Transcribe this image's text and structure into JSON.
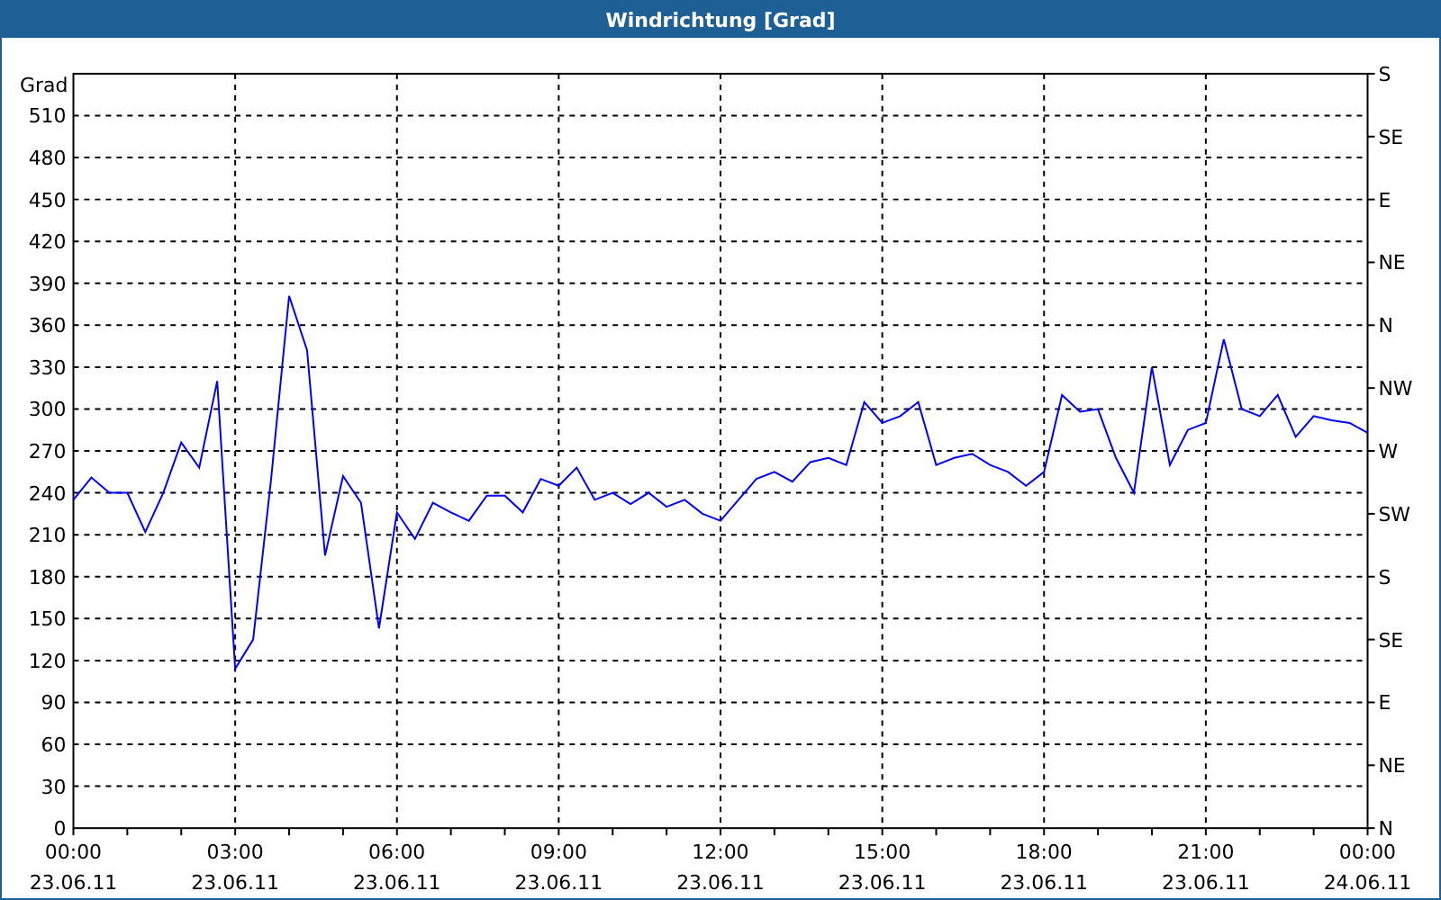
{
  "window": {
    "title": "Windrichtung [Grad]"
  },
  "chart": {
    "compass_labels": [
      "S",
      "SE",
      "E",
      "NE",
      "N",
      "NW",
      "W",
      "SW",
      "S",
      "SE",
      "E",
      "NE",
      "N"
    ],
    "chart_data": {
      "type": "line",
      "ylabel": "Grad",
      "ylim": [
        0,
        540
      ],
      "grid": true,
      "yticks": [
        0,
        30,
        60,
        90,
        120,
        150,
        180,
        210,
        240,
        270,
        300,
        330,
        360,
        390,
        420,
        450,
        480,
        510
      ],
      "categories": [
        "00:00\n23.06.11",
        null,
        null,
        null,
        null,
        null,
        null,
        null,
        null,
        "03:00\n23.06.11",
        null,
        null,
        null,
        null,
        null,
        null,
        null,
        null,
        "06:00\n23.06.11",
        null,
        null,
        null,
        null,
        null,
        null,
        null,
        null,
        "09:00\n23.06.11",
        null,
        null,
        null,
        null,
        null,
        null,
        null,
        null,
        "12:00\n23.06.11",
        null,
        null,
        null,
        null,
        null,
        null,
        null,
        null,
        "15:00\n23.06.11",
        null,
        null,
        null,
        null,
        null,
        null,
        null,
        null,
        "18:00\n23.06.11",
        null,
        null,
        null,
        null,
        null,
        null,
        null,
        null,
        "21:00\n23.06.11",
        null,
        null,
        null,
        null,
        null,
        null,
        null,
        null,
        "00:00\n24.06.11"
      ],
      "series": [
        {
          "color": "#0000ff",
          "values": [
            235,
            251,
            240,
            240,
            212,
            240,
            276,
            258,
            320,
            114,
            135,
            250,
            381,
            342,
            195,
            252,
            233,
            143,
            226,
            207,
            233,
            226,
            220,
            238,
            238,
            226,
            250,
            245,
            258,
            235,
            240,
            232,
            240,
            230,
            235,
            225,
            220,
            235,
            250,
            255,
            248,
            262,
            265,
            260,
            305,
            290,
            295,
            305,
            260,
            265,
            268,
            260,
            255,
            245,
            255,
            310,
            298,
            300,
            265,
            240,
            330,
            260,
            285,
            290,
            350,
            300,
            295,
            310,
            280,
            295,
            292,
            290,
            283
          ]
        }
      ]
    }
  }
}
